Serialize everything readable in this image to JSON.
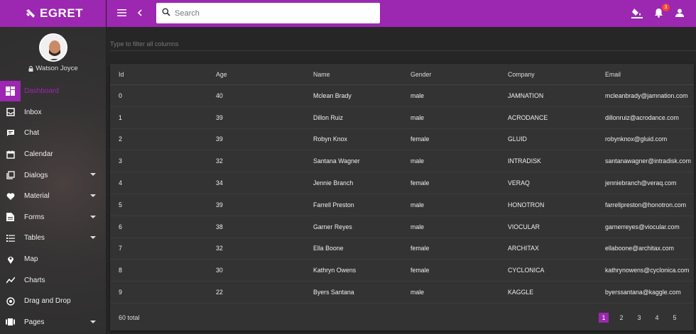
{
  "brand": {
    "name": "EGRET"
  },
  "profile": {
    "name": "Watson Joyce"
  },
  "nav": [
    {
      "label": "Dashboard",
      "icon": "dashboard-icon",
      "active": true,
      "caret": false
    },
    {
      "label": "Inbox",
      "icon": "inbox-icon",
      "active": false,
      "caret": false
    },
    {
      "label": "Chat",
      "icon": "chat-icon",
      "active": false,
      "caret": false
    },
    {
      "label": "Calendar",
      "icon": "calendar-icon",
      "active": false,
      "caret": false
    },
    {
      "label": "Dialogs",
      "icon": "dialogs-icon",
      "active": false,
      "caret": true
    },
    {
      "label": "Material",
      "icon": "heart-icon",
      "active": false,
      "caret": true
    },
    {
      "label": "Forms",
      "icon": "forms-icon",
      "active": false,
      "caret": true
    },
    {
      "label": "Tables",
      "icon": "tables-icon",
      "active": false,
      "caret": true
    },
    {
      "label": "Map",
      "icon": "map-pin-icon",
      "active": false,
      "caret": false
    },
    {
      "label": "Charts",
      "icon": "chart-icon",
      "active": false,
      "caret": false
    },
    {
      "label": "Drag and Drop",
      "icon": "drag-drop-icon",
      "active": false,
      "caret": false
    },
    {
      "label": "Pages",
      "icon": "pages-icon",
      "active": false,
      "caret": true
    }
  ],
  "topbar": {
    "search_placeholder": "Search",
    "notification_count": "3"
  },
  "filter": {
    "placeholder": "Type to filter all columns"
  },
  "table": {
    "columns": [
      "Id",
      "Age",
      "Name",
      "Gender",
      "Company",
      "Email"
    ],
    "rows": [
      [
        "0",
        "40",
        "Mclean Brady",
        "male",
        "JAMNATION",
        "mcleanbrady@jamnation.com"
      ],
      [
        "1",
        "39",
        "Dillon Ruiz",
        "male",
        "ACRODANCE",
        "dillonruiz@acrodance.com"
      ],
      [
        "2",
        "39",
        "Robyn Knox",
        "female",
        "GLUID",
        "robynknox@gluid.com"
      ],
      [
        "3",
        "32",
        "Santana Wagner",
        "male",
        "INTRADISK",
        "santanawagner@intradisk.com"
      ],
      [
        "4",
        "34",
        "Jennie Branch",
        "female",
        "VERAQ",
        "jenniebranch@veraq.com"
      ],
      [
        "5",
        "39",
        "Farrell Preston",
        "male",
        "HONOTRON",
        "farrellpreston@honotron.com"
      ],
      [
        "6",
        "38",
        "Garner Reyes",
        "male",
        "VIOCULAR",
        "garnerreyes@viocular.com"
      ],
      [
        "7",
        "32",
        "Ella Boone",
        "female",
        "ARCHITAX",
        "ellaboone@architax.com"
      ],
      [
        "8",
        "30",
        "Kathryn Owens",
        "female",
        "CYCLONICA",
        "kathrynowens@cyclonica.com"
      ],
      [
        "9",
        "22",
        "Byers Santana",
        "male",
        "KAGGLE",
        "byerssantana@kaggle.com"
      ]
    ],
    "total": "60 total",
    "pages": [
      "1",
      "2",
      "3",
      "4",
      "5"
    ],
    "current_page": "1"
  },
  "colors": {
    "accent": "#9c27b0",
    "badge": "#f44336"
  }
}
